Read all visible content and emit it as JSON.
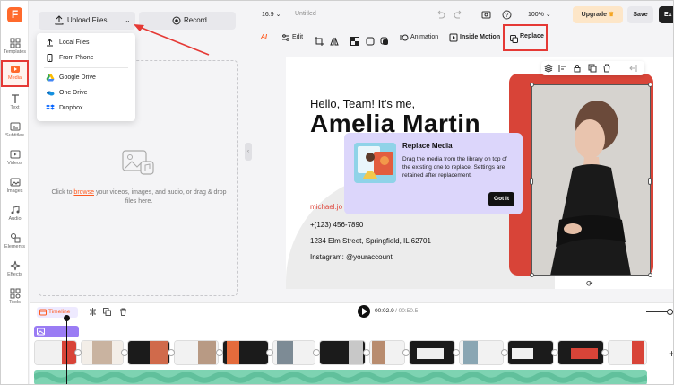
{
  "sidebar": {
    "logo": "F",
    "items": [
      {
        "label": "Templates",
        "icon": "templates-icon"
      },
      {
        "label": "Media",
        "icon": "media-icon",
        "active": true
      },
      {
        "label": "Text",
        "icon": "text-icon"
      },
      {
        "label": "Subtitles",
        "icon": "subtitles-icon"
      },
      {
        "label": "Videos",
        "icon": "videos-icon"
      },
      {
        "label": "Images",
        "icon": "images-icon"
      },
      {
        "label": "Audio",
        "icon": "audio-icon"
      },
      {
        "label": "Elements",
        "icon": "elements-icon"
      },
      {
        "label": "Effects",
        "icon": "effects-icon"
      },
      {
        "label": "Tools",
        "icon": "tools-icon"
      }
    ]
  },
  "panel": {
    "upload_label": "Upload Files",
    "record_label": "Record",
    "dropdown": [
      {
        "label": "Local Files",
        "icon": "upload-icon"
      },
      {
        "label": "From Phone",
        "icon": "phone-icon"
      },
      {
        "label": "Google Drive",
        "icon": "google-drive-icon"
      },
      {
        "label": "One Drive",
        "icon": "onedrive-icon"
      },
      {
        "label": "Dropbox",
        "icon": "dropbox-icon"
      }
    ],
    "drop_prefix": "Click to ",
    "drop_browse": "browse",
    "drop_suffix": " your videos, images, and audio, or drag & drop files here."
  },
  "topbar": {
    "ratio": "16:9",
    "title": "Untitled",
    "zoom": "100%",
    "upgrade": "Upgrade",
    "save": "Save",
    "export": "Ex"
  },
  "toolbar": {
    "ai": "AI",
    "edit": "Edit",
    "animation": "Animation",
    "inside_motion": "Inside Motion",
    "replace": "Replace"
  },
  "canvas": {
    "hello": "Hello, Team! It's me,",
    "name": "Amelia Martin",
    "email": "michael.jo",
    "phone": "+(123) 456-7890",
    "address": "1234 Elm Street, Springfield, IL 62701",
    "social": "Instagram: @youraccount"
  },
  "tooltip": {
    "title": "Replace Media",
    "body": "Drag the media from the library on top of the existing one to replace. Settings are retained after replacement.",
    "button": "Got it"
  },
  "timeline": {
    "label": "Timeline",
    "current_time": "00:02.9",
    "total_time": "/ 00:50.5"
  },
  "colors": {
    "accent": "#ff5a1f",
    "highlight_red": "#e53935",
    "photo_bg": "#d84438",
    "tooltip_bg": "#dcd6fb",
    "audio_track": "#7ed3b2",
    "text_track": "#9a7cf4"
  }
}
